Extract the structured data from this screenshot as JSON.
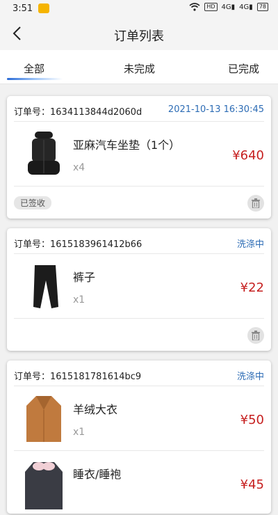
{
  "status_bar": {
    "time": "3:51",
    "hd": "HD",
    "signal1": "4G",
    "signal2": "4G",
    "battery": "78"
  },
  "nav": {
    "title": "订单列表"
  },
  "tabs": [
    {
      "label": "全部"
    },
    {
      "label": "未完成"
    },
    {
      "label": "已完成"
    }
  ],
  "orders": [
    {
      "order_no": "订单号：1634113844d2060d",
      "meta": "2021-10-13 16:30:45",
      "items": [
        {
          "name": "亚麻汽车坐垫（1个）",
          "qty": "x4",
          "price": "¥640"
        }
      ],
      "badge": "已签收"
    },
    {
      "order_no": "订单号：1615183961412b66",
      "meta": "洗涤中",
      "items": [
        {
          "name": "裤子",
          "qty": "x1",
          "price": "¥22"
        }
      ]
    },
    {
      "order_no": "订单号：1615181781614bc9",
      "meta": "洗涤中",
      "items": [
        {
          "name": "羊绒大衣",
          "qty": "x1",
          "price": "¥50"
        },
        {
          "name": "睡衣/睡袍",
          "qty": "",
          "price": "¥45"
        }
      ]
    }
  ],
  "colors": {
    "accent": "#2d6cb5",
    "price": "#c61f1f"
  }
}
